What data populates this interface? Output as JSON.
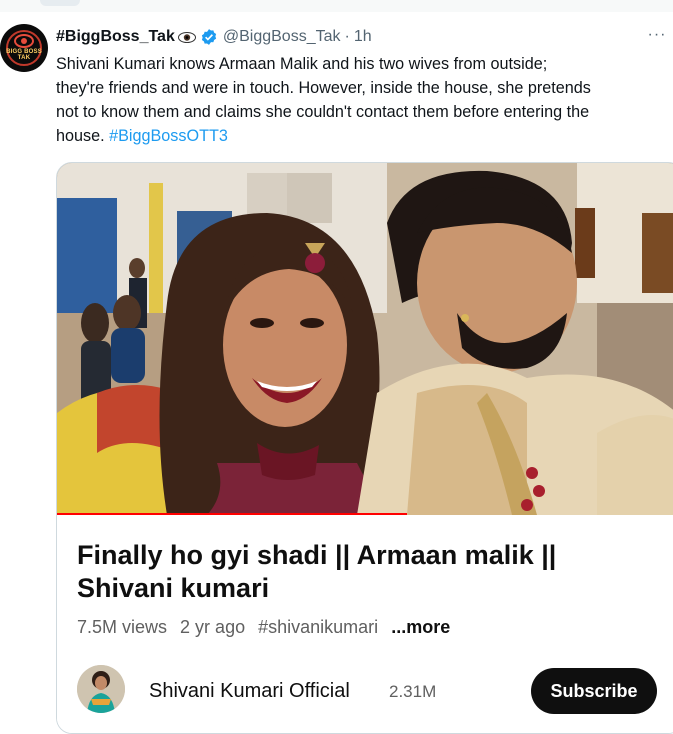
{
  "tweet": {
    "author_name": "#BiggBoss_Tak",
    "handle": "@BiggBoss_Tak",
    "separator": "·",
    "time": "1h",
    "more_label": "···",
    "avatar_text": "BIGG BOSS TAK",
    "text_lines": [
      "Shivani Kumari knows Armaan Malik and his two wives from outside;",
      "they're friends and were in touch. However, inside the house, she pretends",
      "not to know them and claims she couldn't contact them before entering the",
      "house."
    ],
    "hashtag": "#BiggBossOTT3"
  },
  "video_card": {
    "title_line1": "Finally ho gyi shadi || Armaan malik ||",
    "title_line2": "Shivani kumari",
    "views": "7.5M views",
    "age": "2 yr ago",
    "tag": "#shivanikumari",
    "more": "...more",
    "channel_name": "Shivani Kumari Official",
    "subscribers": "2.31M",
    "subscribe_label": "Subscribe"
  },
  "colors": {
    "link": "#1d9bf0",
    "verified": "#1d9bf0",
    "subscribe_bg": "#0f0f0f",
    "progress": "#ff0000"
  },
  "icons": [
    "eye-icon",
    "verified-badge-icon",
    "more-options-icon"
  ]
}
